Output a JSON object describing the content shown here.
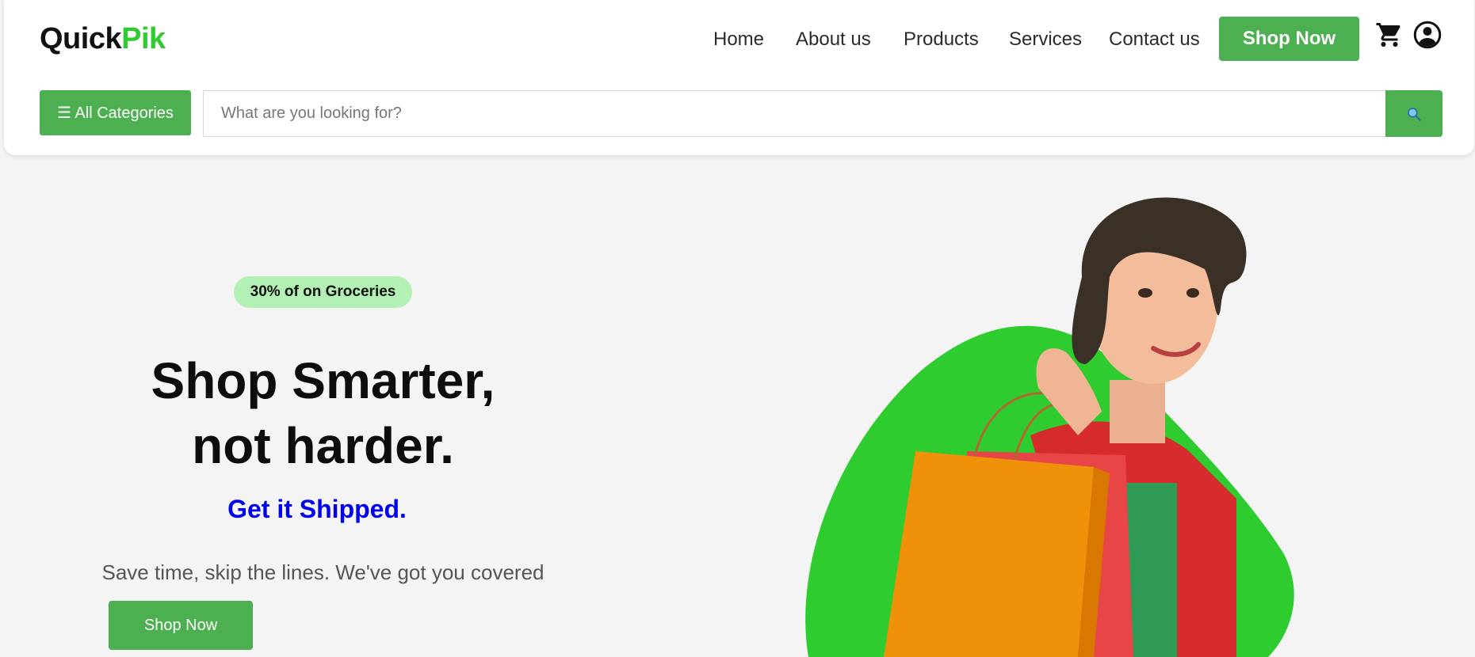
{
  "brand": {
    "part1": "Quick",
    "part2": "Pik",
    "accent": "#2ecc2e"
  },
  "nav": {
    "items": [
      "Home",
      "About us",
      "Products",
      "Services",
      "Contact us"
    ],
    "shop_now": "Shop Now",
    "cart_icon": "shopping-cart-icon",
    "account_icon": "user-account-icon"
  },
  "search": {
    "categories_label": "☰ All Categories",
    "placeholder": "What are you looking for?",
    "button_icon": "search-icon"
  },
  "hero": {
    "badge": "30% of on Groceries",
    "title_line1": "Shop Smarter,",
    "title_line2": "not harder.",
    "subtitle": "Get it Shipped.",
    "description": "Save time, skip the lines. We've got you covered",
    "cta": "Shop Now",
    "image": "woman-with-shopping-bags"
  },
  "colors": {
    "primary": "#4caf50",
    "badge_bg": "#b3f0b3",
    "blob": "#2ecc2e",
    "subtitle": "#0000ee"
  }
}
